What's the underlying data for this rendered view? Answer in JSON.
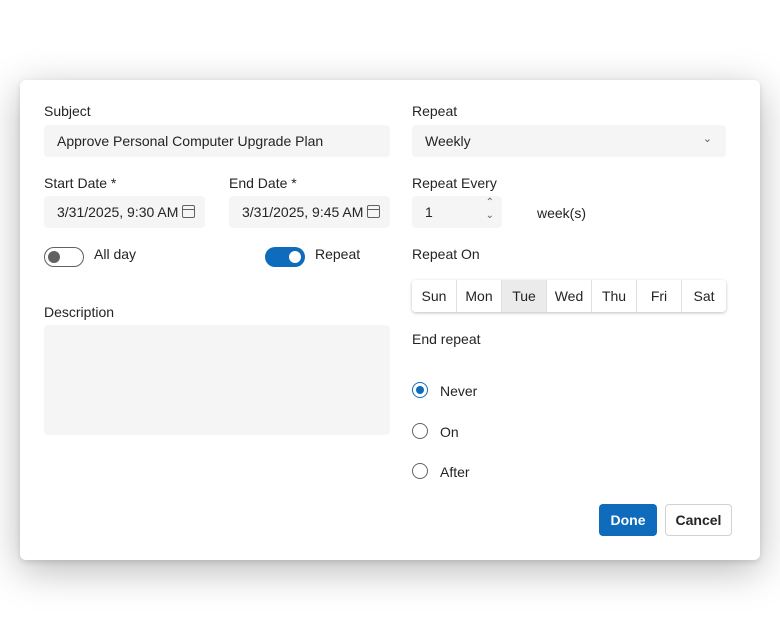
{
  "subject": {
    "label": "Subject",
    "value": "Approve Personal Computer Upgrade Plan"
  },
  "start_date": {
    "label": "Start Date *",
    "value": "3/31/2025, 9:30 AM"
  },
  "end_date": {
    "label": "End Date *",
    "value": "3/31/2025, 9:45 AM"
  },
  "all_day": {
    "label": "All day",
    "on": false
  },
  "repeat_toggle": {
    "label": "Repeat",
    "on": true
  },
  "description": {
    "label": "Description",
    "value": ""
  },
  "repeat": {
    "label": "Repeat",
    "value": "Weekly"
  },
  "repeat_every": {
    "label": "Repeat Every",
    "value": "1",
    "unit": "week(s)"
  },
  "repeat_on": {
    "label": "Repeat On",
    "days": [
      "Sun",
      "Mon",
      "Tue",
      "Wed",
      "Thu",
      "Fri",
      "Sat"
    ],
    "selected": "Tue"
  },
  "end_repeat": {
    "label": "End repeat",
    "options": [
      "Never",
      "On",
      "After"
    ],
    "selected": "Never"
  },
  "buttons": {
    "done": "Done",
    "cancel": "Cancel"
  },
  "colors": {
    "accent": "#0f6cbd"
  }
}
